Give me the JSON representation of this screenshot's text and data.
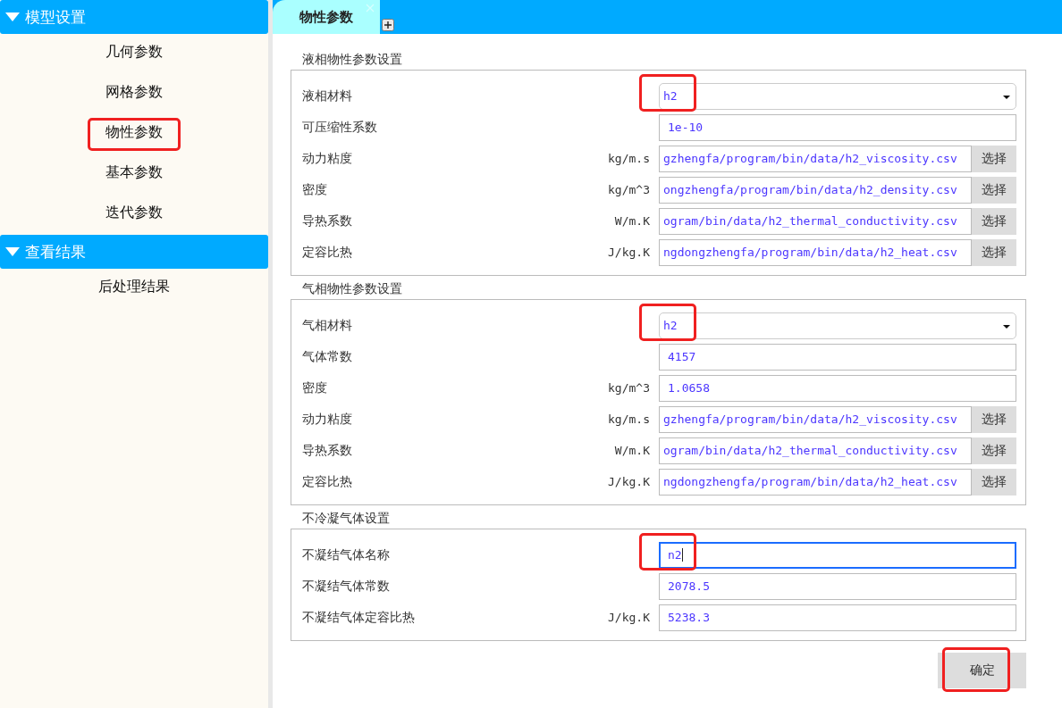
{
  "sidebar": {
    "groups": [
      {
        "title": "模型设置",
        "expanded": true,
        "items": [
          {
            "label": "几何参数",
            "highlighted": false
          },
          {
            "label": "网格参数",
            "highlighted": false
          },
          {
            "label": "物性参数",
            "highlighted": true
          },
          {
            "label": "基本参数",
            "highlighted": false
          },
          {
            "label": "迭代参数",
            "highlighted": false
          }
        ]
      },
      {
        "title": "查看结果",
        "expanded": true,
        "items": [
          {
            "label": "后处理结果",
            "highlighted": false
          }
        ]
      }
    ]
  },
  "tabs": [
    {
      "label": "物性参数",
      "selected": true
    }
  ],
  "sections": [
    {
      "title": "液相物性参数设置",
      "rows": [
        {
          "kind": "select",
          "label": "液相材料",
          "value": "h2",
          "highlighted": true,
          "focused": false
        },
        {
          "kind": "input",
          "label": "可压缩性系数",
          "value": "1e-10",
          "highlighted": false,
          "focused": false
        },
        {
          "kind": "file",
          "label": "动力粘度",
          "unit": "kg/m.s",
          "value": "gzhengfa/program/bin/data/h2_viscosity.csv",
          "button": "选择",
          "highlighted": false,
          "focused": false
        },
        {
          "kind": "file",
          "label": "密度",
          "unit": "kg/m^3",
          "value": "ongzhengfa/program/bin/data/h2_density.csv",
          "button": "选择",
          "highlighted": false,
          "focused": false
        },
        {
          "kind": "file",
          "label": "导热系数",
          "unit": "W/m.K",
          "value": "ogram/bin/data/h2_thermal_conductivity.csv",
          "button": "选择",
          "highlighted": false,
          "focused": false
        },
        {
          "kind": "file",
          "label": "定容比热",
          "unit": "J/kg.K",
          "value": "ngdongzhengfa/program/bin/data/h2_heat.csv",
          "button": "选择",
          "highlighted": false,
          "focused": false
        }
      ]
    },
    {
      "title": "气相物性参数设置",
      "rows": [
        {
          "kind": "select",
          "label": "气相材料",
          "value": "h2",
          "highlighted": true,
          "focused": false
        },
        {
          "kind": "input",
          "label": "气体常数",
          "value": "4157",
          "highlighted": false,
          "focused": false
        },
        {
          "kind": "input",
          "label": "密度",
          "unit": "kg/m^3",
          "value": "1.0658",
          "highlighted": false,
          "focused": false
        },
        {
          "kind": "file",
          "label": "动力粘度",
          "unit": "kg/m.s",
          "value": "gzhengfa/program/bin/data/h2_viscosity.csv",
          "button": "选择",
          "highlighted": false,
          "focused": false
        },
        {
          "kind": "file",
          "label": "导热系数",
          "unit": "W/m.K",
          "value": "ogram/bin/data/h2_thermal_conductivity.csv",
          "button": "选择",
          "highlighted": false,
          "focused": false
        },
        {
          "kind": "file",
          "label": "定容比热",
          "unit": "J/kg.K",
          "value": "ngdongzhengfa/program/bin/data/h2_heat.csv",
          "button": "选择",
          "highlighted": false,
          "focused": false
        }
      ]
    },
    {
      "title": "不冷凝气体设置",
      "rows": [
        {
          "kind": "input",
          "label": "不凝结气体名称",
          "value": "n2",
          "highlighted": true,
          "focused": true
        },
        {
          "kind": "input",
          "label": "不凝结气体常数",
          "value": "2078.5",
          "highlighted": false,
          "focused": false
        },
        {
          "kind": "input",
          "label": "不凝结气体定容比热",
          "unit": "J/kg.K",
          "value": "5238.3",
          "highlighted": false,
          "focused": false
        }
      ]
    }
  ],
  "confirm": {
    "label": "确定",
    "highlighted": true
  }
}
